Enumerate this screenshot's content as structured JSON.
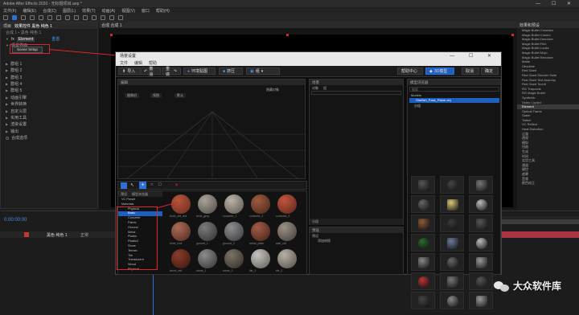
{
  "window": {
    "title": "Adobe After Effects 2020 - 无标题项目.aep *",
    "controls": "— ☐ ✕"
  },
  "menubar": [
    "文件(F)",
    "编辑(E)",
    "合成(C)",
    "图层(L)",
    "效果(T)",
    "动画(A)",
    "视图(V)",
    "窗口",
    "帮助(H)"
  ],
  "left_panel": {
    "tabs": [
      "项目",
      "效果控件 黑色 纯色 1"
    ],
    "layer_header": "合成 1 • 黑色 纯色 1",
    "effect_name": "Element",
    "reset": "重置",
    "scene_setup_button": "Scene Setup",
    "rows": [
      "场景界面",
      "群组 1",
      "群组 2",
      "群组 3",
      "群组 4",
      "群组 5",
      "动画引擎",
      "世界转换",
      "自定义层",
      "实用工具",
      "渲染设置",
      "输出",
      "合成选项"
    ]
  },
  "comp": {
    "tab": "合成 合成 1"
  },
  "right_panel": {
    "header": "效果和预设",
    "items": [
      "Magic Bullet Colorista",
      "Magic Bullet Cosmo",
      "Magic Bullet Denoiser",
      "Magic Bullet Film",
      "Magic Bullet Looks",
      "Magic Bullet Mojo",
      "Magic Bullet Renoiser",
      "Matte",
      "Obsolete",
      "Red Giant",
      "Red Giant Shooter Suite",
      "Red Giant Text Anarchy",
      "Red Giant Toonit",
      "RG Trapcode",
      "RG Magic Bullet",
      "Synthetic",
      "Video Copilot",
      "Element",
      "Optical Flares",
      "Saber",
      "Twitch",
      "VC Reflect",
      "Heat Distortion",
      "过渡",
      "透视",
      "模拟",
      "扭曲",
      "生成",
      "时间",
      "实用工具",
      "通道",
      "键控",
      "遮罩",
      "音频",
      "颜色校正"
    ]
  },
  "popup": {
    "title": "场景设置",
    "controls": "— ☐ ✕",
    "menu": [
      "文件",
      "编辑",
      "帮助"
    ],
    "toolbar": {
      "import": "导入",
      "undo": "撤消",
      "redo": "重做",
      "env": "环境贴图",
      "extrude": "挤压",
      "group": "组",
      "help_center": "帮助中心",
      "models_3d": "3D模型",
      "cancel": "取消",
      "ok": "确定"
    },
    "viewport": {
      "tab": "编辑",
      "camera": "摄像机",
      "view": "视图",
      "preset": "默认",
      "label": "隐藏对象"
    },
    "scene": {
      "tab": "场景",
      "t1": "对象",
      "t2": "组",
      "items": [
        "Modelo",
        "Starfish_Pack_Plane.obj",
        "分组"
      ]
    },
    "library": {
      "tab": "模型浏览器",
      "search": "搜索",
      "folder_models": "Models",
      "folder_selected": "Starfish_Pack_Plane.obj",
      "folder_sub": "分组"
    },
    "presets": {
      "label": "预设",
      "t1": "预设",
      "items": [
        "添加材质"
      ]
    },
    "materials": {
      "tabs": [
        "预设",
        "模型浏览器"
      ],
      "tree": [
        "VC Preset",
        "Materials",
        "Physical",
        "Basic",
        "Concrete",
        "Fabric",
        "Ground",
        "Metal",
        "Plastic",
        "Plastic2",
        "Stone",
        "Terrain",
        "Tile",
        "Translucent",
        "Wood",
        "Physical"
      ],
      "sphere_labels": [
        "brick_old_red",
        "brick_grey",
        "concrete_1",
        "concrete_2",
        "concrete_3",
        "brick_roof",
        "ground_1",
        "ground_2",
        "metal_plate",
        "wall_old",
        "wood_red",
        "stone_1",
        "stone_2",
        "tile_1",
        "tile_2"
      ]
    }
  },
  "timeline": {
    "time": "0:00:00:00",
    "layer_name": "黑色 纯色 1",
    "mode": "正常"
  },
  "watermark": {
    "text": "大众软件库"
  },
  "colors": {
    "accent": "#2d6fd6",
    "annotation": "#e0242b"
  }
}
